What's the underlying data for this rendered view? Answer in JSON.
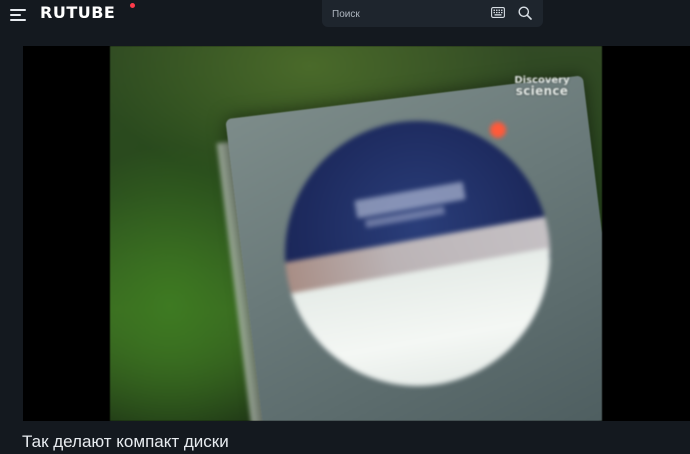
{
  "header": {
    "logo": "RUTUBE",
    "search": {
      "placeholder": "Поиск"
    }
  },
  "video": {
    "watermark_line1": "Discovery",
    "watermark_line2": "science",
    "title": "Так делают компакт диски"
  },
  "icons": {
    "menu": "menu-icon",
    "keyboard": "keyboard-icon",
    "search": "search-icon"
  },
  "colors": {
    "background": "#14191f",
    "search_bg": "#1e252d",
    "logo_accent": "#ff3a4a",
    "text": "#e8ecf0"
  }
}
